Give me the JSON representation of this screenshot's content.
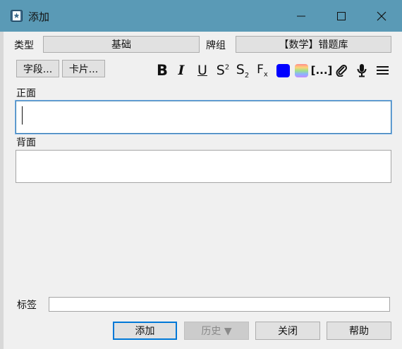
{
  "window": {
    "title": "添加"
  },
  "titlebar_icons": {
    "app": "anki-icon",
    "minimize": "minimize-icon",
    "maximize": "maximize-icon",
    "close": "close-icon"
  },
  "type_row": {
    "type_label": "类型",
    "type_value": "基础",
    "deck_label": "牌组",
    "deck_value": "【数学】错题库"
  },
  "buttons": {
    "fields": "字段...",
    "cards": "卡片..."
  },
  "toolbar": {
    "bold": "B",
    "italic": "I",
    "underline": "U",
    "superscript": "S",
    "superscript_mark": "2",
    "subscript": "S",
    "subscript_mark": "2",
    "clear": "F",
    "clear_mark": "x",
    "cloze": "[...]",
    "text_color": "#0000ff"
  },
  "fields": {
    "front_label": "正面",
    "back_label": "背面"
  },
  "tags": {
    "label": "标签",
    "value": ""
  },
  "bottom": {
    "add": "添加",
    "history": "历史 ▼",
    "close": "关闭",
    "help": "帮助"
  }
}
